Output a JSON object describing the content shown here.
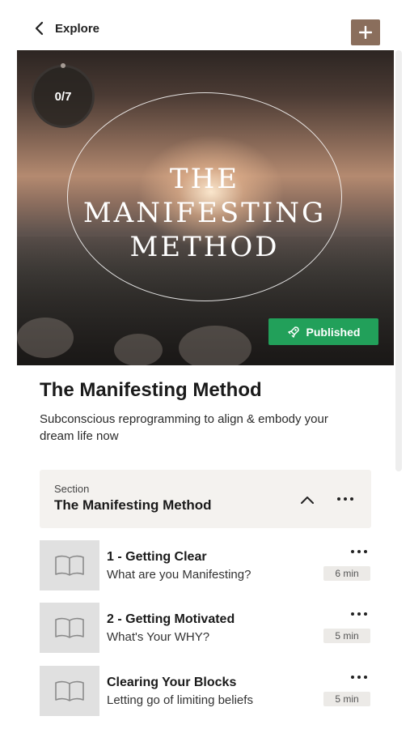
{
  "header": {
    "back_label": "Explore"
  },
  "hero": {
    "progress": "0/7",
    "cover_lines": [
      "THE",
      "MANIFESTING",
      "METHOD"
    ],
    "status": "Published",
    "status_color": "#22a05a"
  },
  "course": {
    "title": "The Manifesting Method",
    "description": "Subconscious reprogramming to align & embody your dream life now"
  },
  "section": {
    "label": "Section",
    "title": "The Manifesting Method"
  },
  "lessons": [
    {
      "title": "1 - Getting Clear",
      "subtitle": "What are you Manifesting?",
      "duration": "6 min"
    },
    {
      "title": "2 - Getting Motivated",
      "subtitle": "What's Your WHY?",
      "duration": "5 min"
    },
    {
      "title": "Clearing Your Blocks",
      "subtitle": "Letting go of limiting beliefs",
      "duration": "5 min"
    }
  ],
  "colors": {
    "accent_button": "#8a6e5c",
    "section_bg": "#f4f2ef"
  }
}
